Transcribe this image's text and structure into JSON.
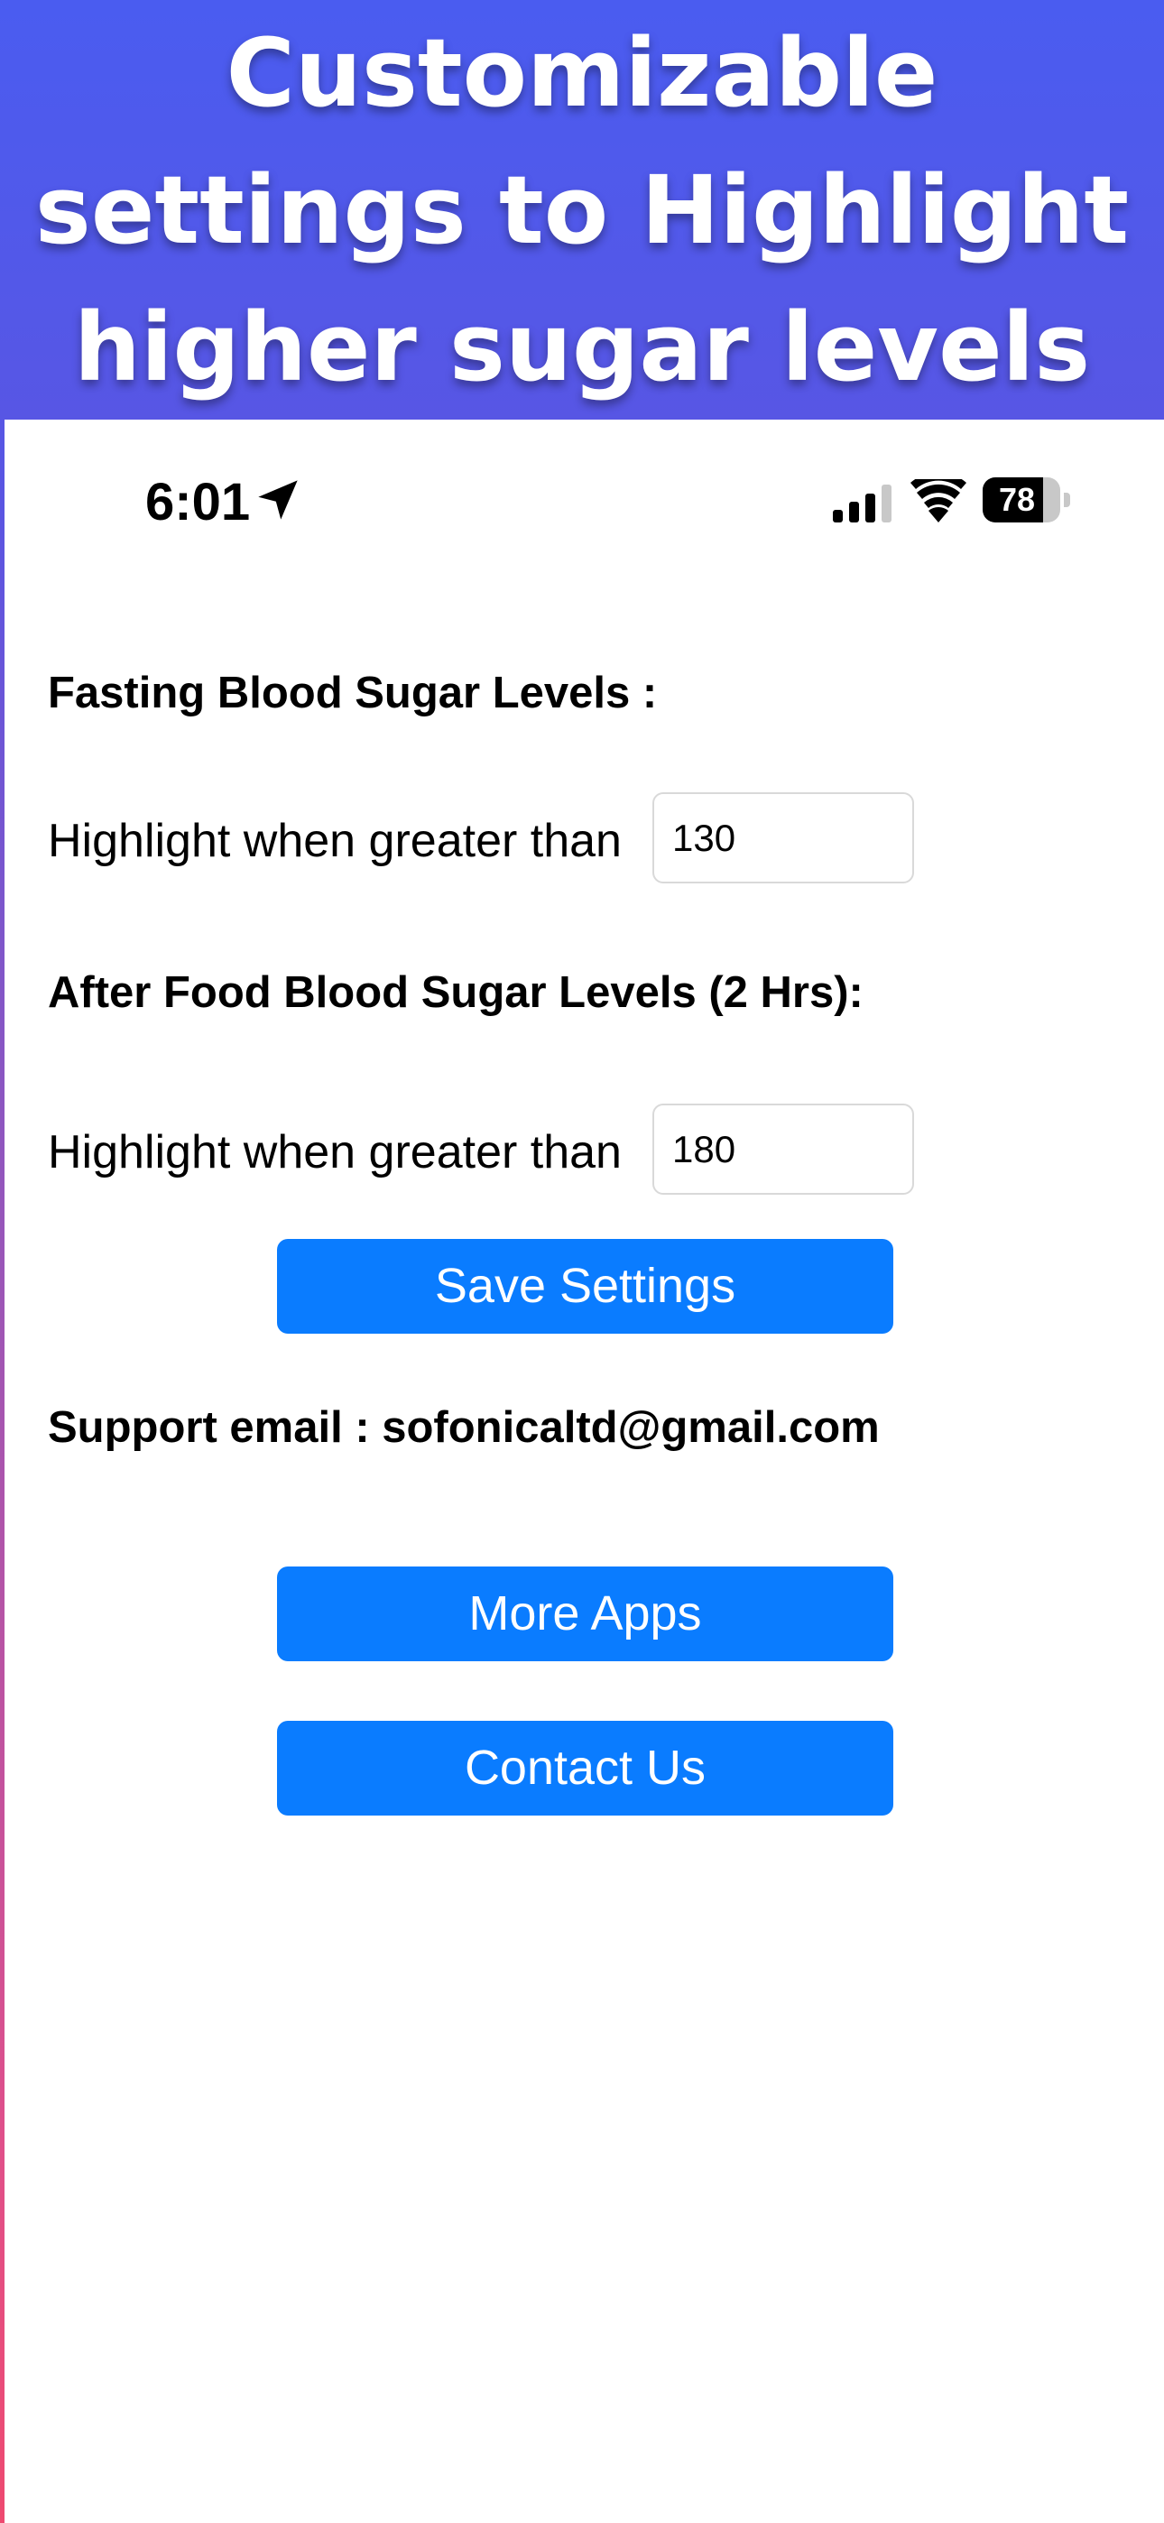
{
  "banner": {
    "title": "Customizable settings to Highlight higher sugar levels"
  },
  "status_bar": {
    "time": "6:01",
    "battery_percent": 78,
    "battery_label": "78",
    "icons": [
      "location-arrow-icon",
      "cellular-signal-icon",
      "wifi-icon",
      "battery-icon"
    ]
  },
  "settings": {
    "fasting_heading": "Fasting Blood Sugar Levels :",
    "fasting_label": "Highlight when greater than",
    "fasting_value": "130",
    "after_food_heading": "After Food Blood Sugar Levels (2 Hrs):",
    "after_food_label": "Highlight when greater than",
    "after_food_value": "180",
    "save_button": "Save Settings"
  },
  "support": {
    "text": "Support email : sofonicaltd@gmail.com"
  },
  "actions": {
    "more_apps": "More Apps",
    "contact_us": "Contact Us"
  },
  "colors": {
    "button_blue": "#0a7cff",
    "banner_blue": "#4a5cf0",
    "input_border": "#d9d9d9"
  }
}
